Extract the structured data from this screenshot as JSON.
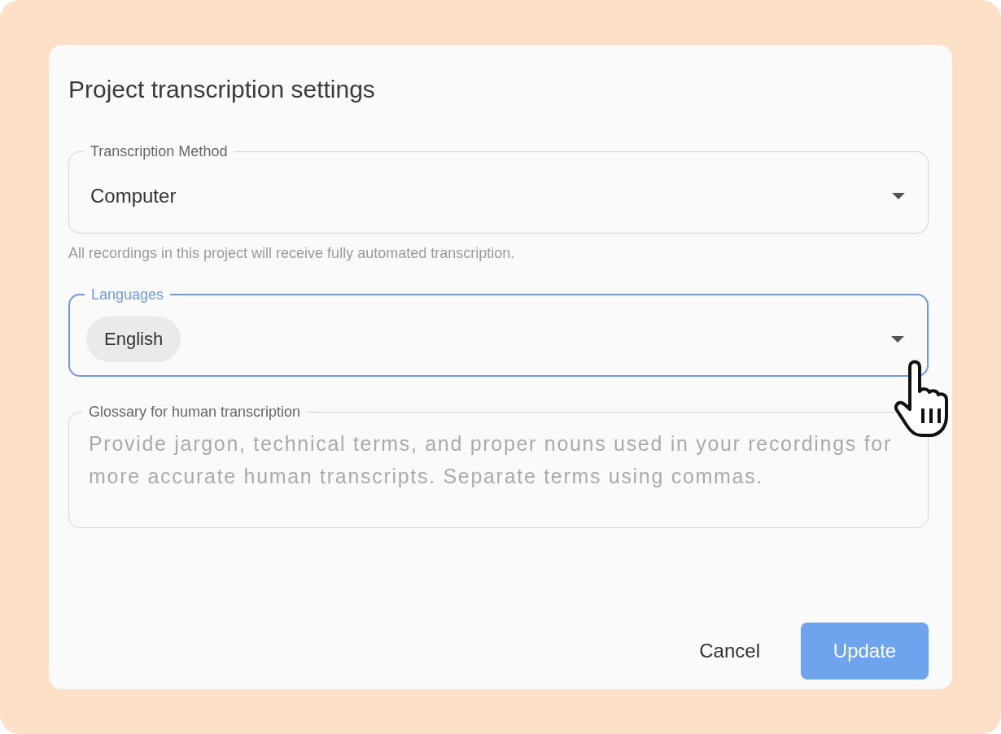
{
  "dialog": {
    "title": "Project transcription settings"
  },
  "fields": [
    {
      "kind": "select",
      "label": "Transcription Method",
      "value": "Computer",
      "focused": false,
      "helper": "All recordings in this project will receive fully automated transcription."
    },
    {
      "kind": "chips",
      "label": "Languages",
      "chips": [
        "English"
      ],
      "focused": true
    },
    {
      "kind": "textarea",
      "label": "Glossary for human transcription",
      "placeholder": "Provide jargon, technical terms, and proper nouns used in your recordings for more accurate human transcripts. Separate terms using commas.",
      "focused": false
    }
  ],
  "buttons": [
    {
      "kind": "text",
      "label": "Cancel",
      "disabled": false
    },
    {
      "kind": "primary",
      "label": "Update",
      "disabled": true
    }
  ]
}
